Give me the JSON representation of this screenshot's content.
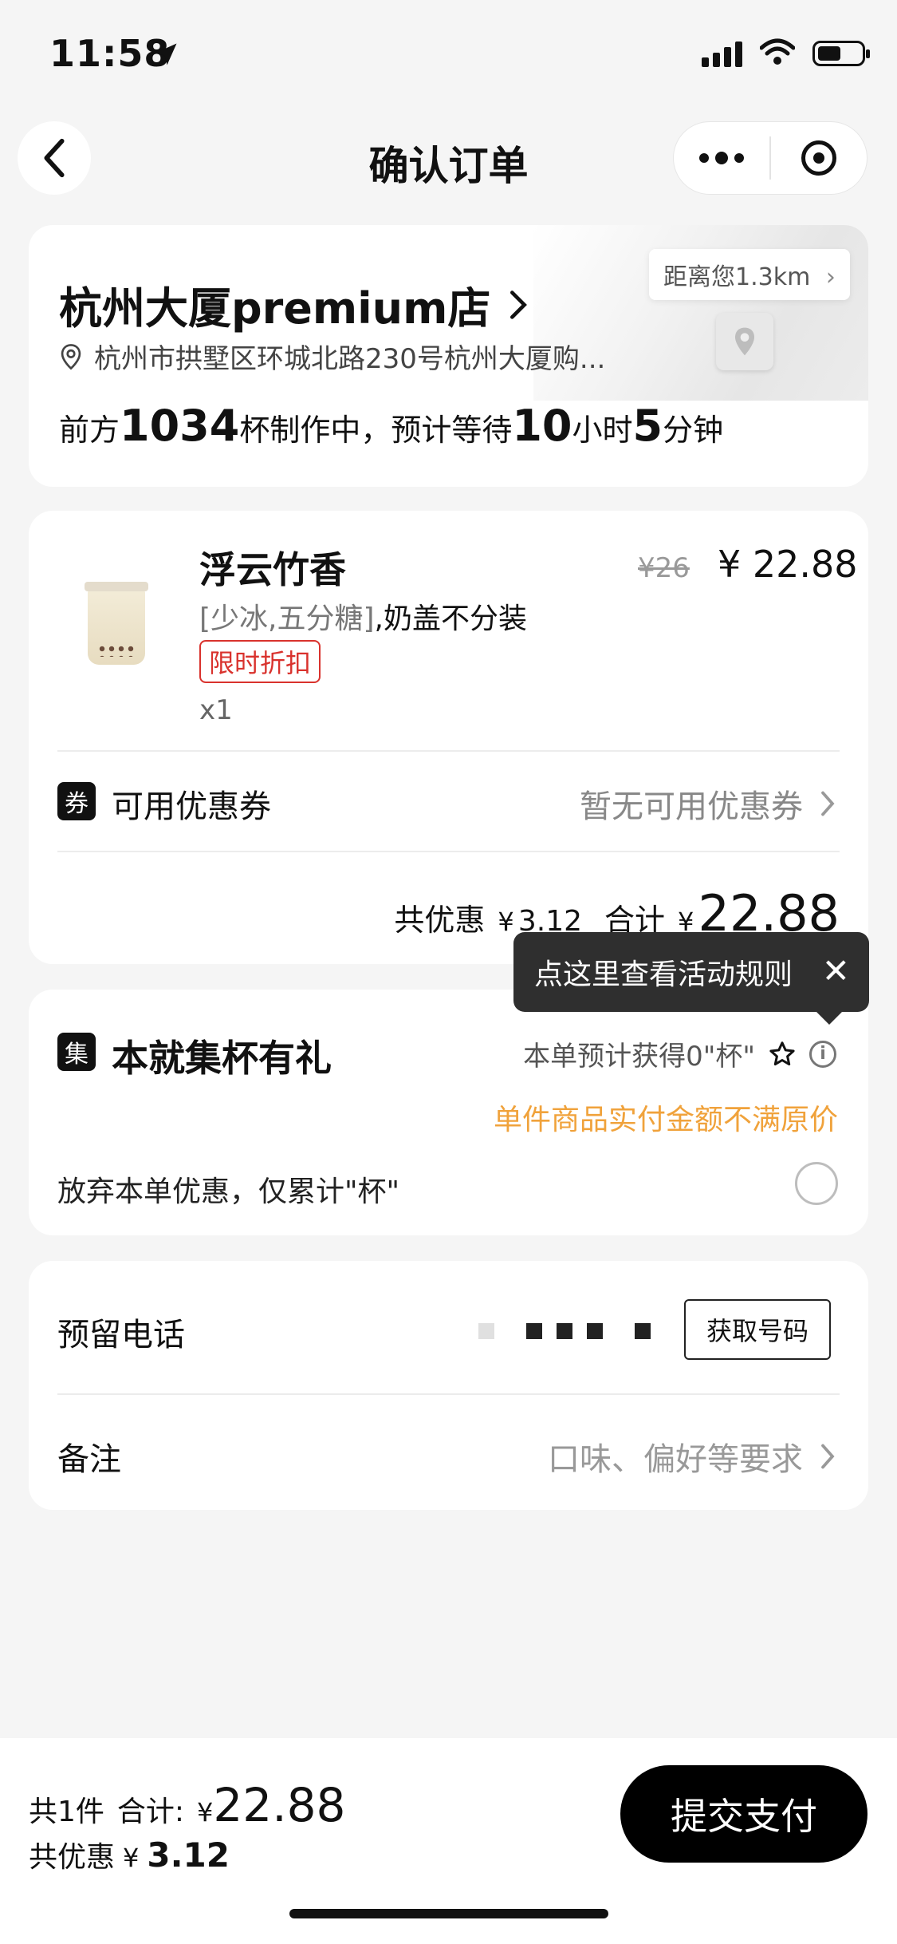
{
  "status_bar": {
    "time": "11:58"
  },
  "nav": {
    "title": "确认订单"
  },
  "store": {
    "name": "杭州大厦premium店",
    "address": "杭州市拱墅区环城北路230号杭州大厦购...",
    "distance": "距离您1.3km",
    "queue_prefix": "前方",
    "queue_cups": "1034",
    "queue_mid": "杯制作中，预计等待",
    "wait_hours": "10",
    "hours_unit": "小时",
    "wait_minutes": "5",
    "minutes_unit": "分钟"
  },
  "product": {
    "name": "浮云竹香",
    "options_bracket": "[少冰,五分糖]",
    "options_extra": ",奶盖不分装",
    "tag": "限时折扣",
    "qty": "x1",
    "original_price": "¥26",
    "price": "¥ 22.88"
  },
  "coupon": {
    "icon_char": "券",
    "label": "可用优惠券",
    "value": "暂无可用优惠券"
  },
  "summary": {
    "discount_label": "共优惠",
    "currency": "¥",
    "discount": "3.12",
    "total_label": "合计",
    "total": "22.88"
  },
  "tooltip": {
    "text": "点这里查看活动规则",
    "close": "✕"
  },
  "collect": {
    "icon_char": "集",
    "title": "本就集杯有礼",
    "estimate": "本单预计获得0\"杯\"",
    "note": "单件商品实付金额不满原价",
    "waive_label": "放弃本单优惠，仅累计\"杯\""
  },
  "contact": {
    "phone_label": "预留电话",
    "get_number": "获取号码",
    "note_label": "备注",
    "note_placeholder": "口味、偏好等要求"
  },
  "bottom": {
    "count_label": "共1件",
    "total_label": "合计:",
    "currency": "¥",
    "total": "22.88",
    "saved_label": "共优惠",
    "saved": "3.12",
    "submit": "提交支付"
  }
}
